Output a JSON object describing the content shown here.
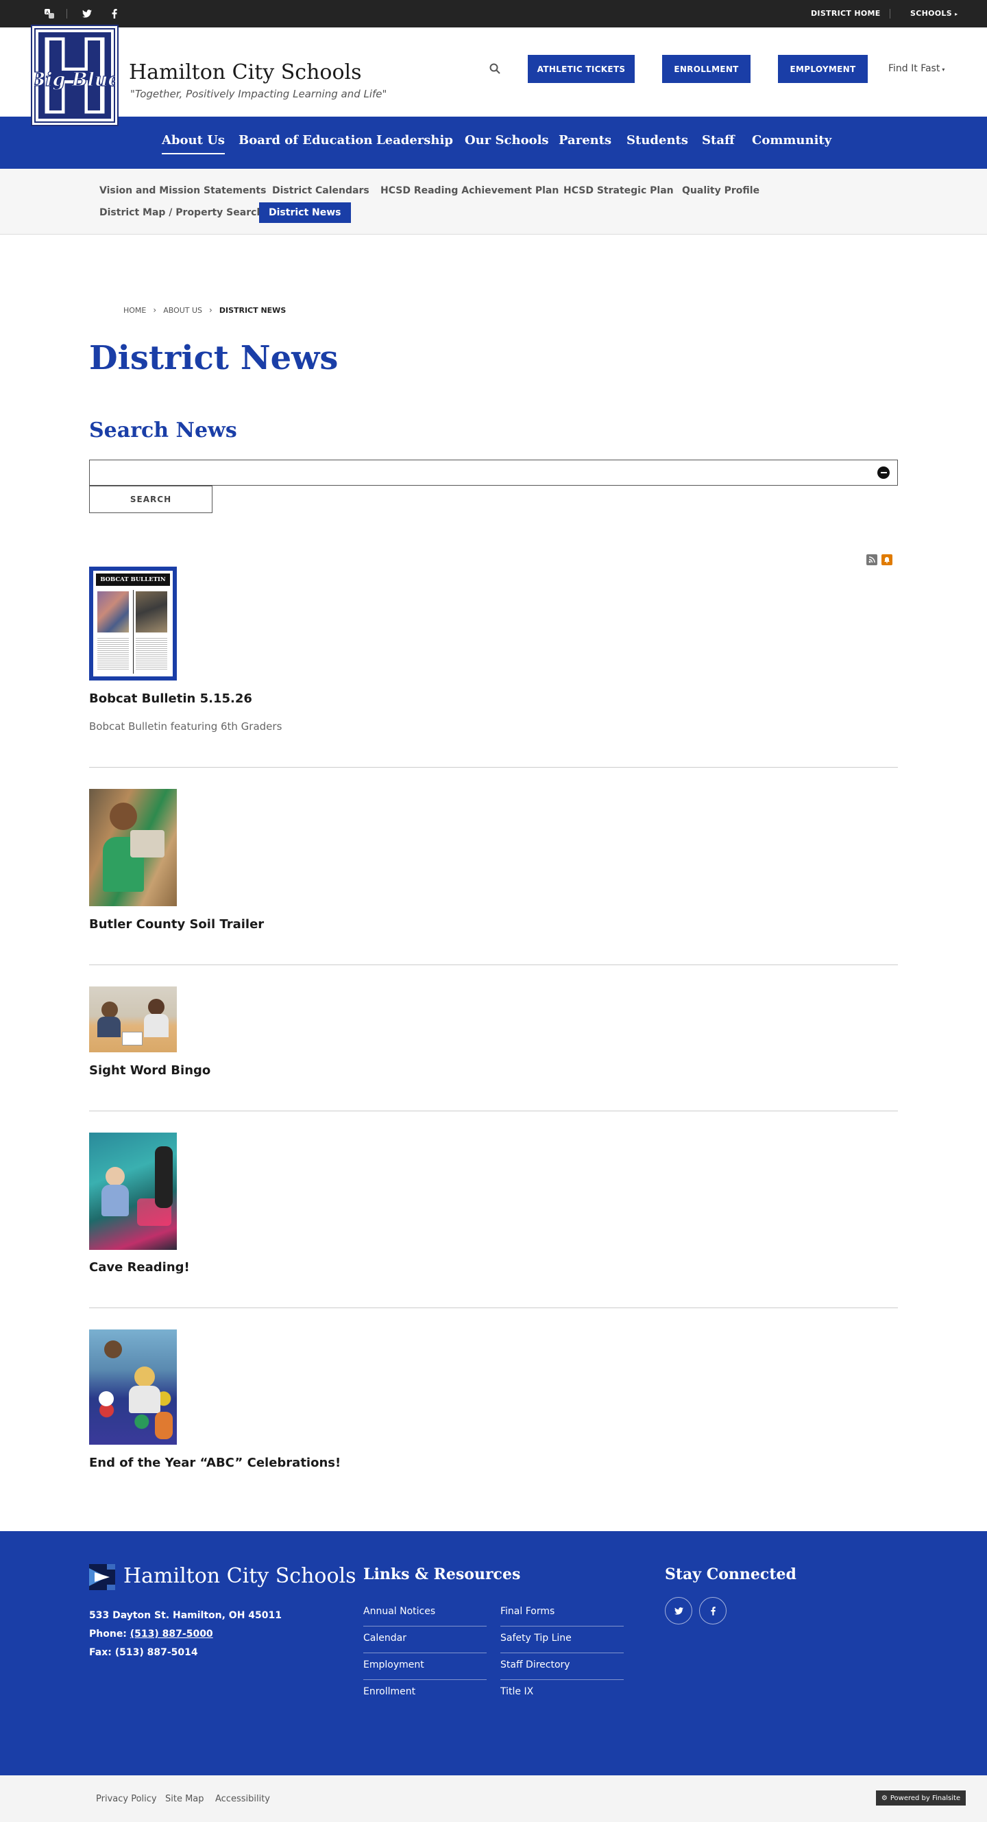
{
  "topbar": {
    "district_home": "DISTRICT HOME",
    "schools": "SCHOOLS"
  },
  "header": {
    "logo_text": "Big Blue",
    "title": "Hamilton City Schools",
    "tagline": "\"Together, Positively Impacting Learning and Life\"",
    "buttons": [
      "ATHLETIC TICKETS",
      "ENROLLMENT",
      "EMPLOYMENT"
    ],
    "find_it_fast": "Find It Fast"
  },
  "main_nav": [
    "About Us",
    "Board of Education",
    "Leadership",
    "Our Schools",
    "Parents",
    "Students",
    "Staff",
    "Community"
  ],
  "sub_nav": [
    "Vision and Mission Statements",
    "District Calendars",
    "HCSD Reading Achievement Plan",
    "HCSD Strategic Plan",
    "Quality Profile",
    "District Map / Property Search",
    "District News"
  ],
  "breadcrumb": [
    "HOME",
    "ABOUT US",
    "DISTRICT NEWS"
  ],
  "page_title": "District News",
  "search": {
    "heading": "Search News",
    "value": "",
    "button": "SEARCH"
  },
  "news": [
    {
      "title": "Bobcat Bulletin 5.15.26",
      "description": "Bobcat Bulletin featuring 6th Graders",
      "thumb_text": "BOBCAT BULLETIN"
    },
    {
      "title": "Butler County Soil Trailer"
    },
    {
      "title": "Sight Word Bingo"
    },
    {
      "title": "Cave Reading!"
    },
    {
      "title": "End of the Year “ABC” Celebrations!"
    }
  ],
  "footer": {
    "title": "Hamilton City Schools",
    "address": "533 Dayton St. Hamilton, OH  45011",
    "phone_label": "Phone:",
    "phone": "(513) 887-5000",
    "fax_label": "Fax:",
    "fax": "(513) 887-5014",
    "links_heading": "Links & Resources",
    "links_col1": [
      "Annual Notices",
      "Calendar",
      "Employment",
      "Enrollment"
    ],
    "links_col2": [
      "Final Forms",
      "Safety Tip Line",
      "Staff Directory",
      "Title IX"
    ],
    "stay_heading": "Stay Connected"
  },
  "bottom": {
    "links": [
      "Privacy Policy",
      "Site Map",
      "Accessibility"
    ],
    "powered": "Powered by Finalsite"
  },
  "colors": {
    "brand_blue": "#1a3ea7",
    "topbar": "#242424"
  }
}
